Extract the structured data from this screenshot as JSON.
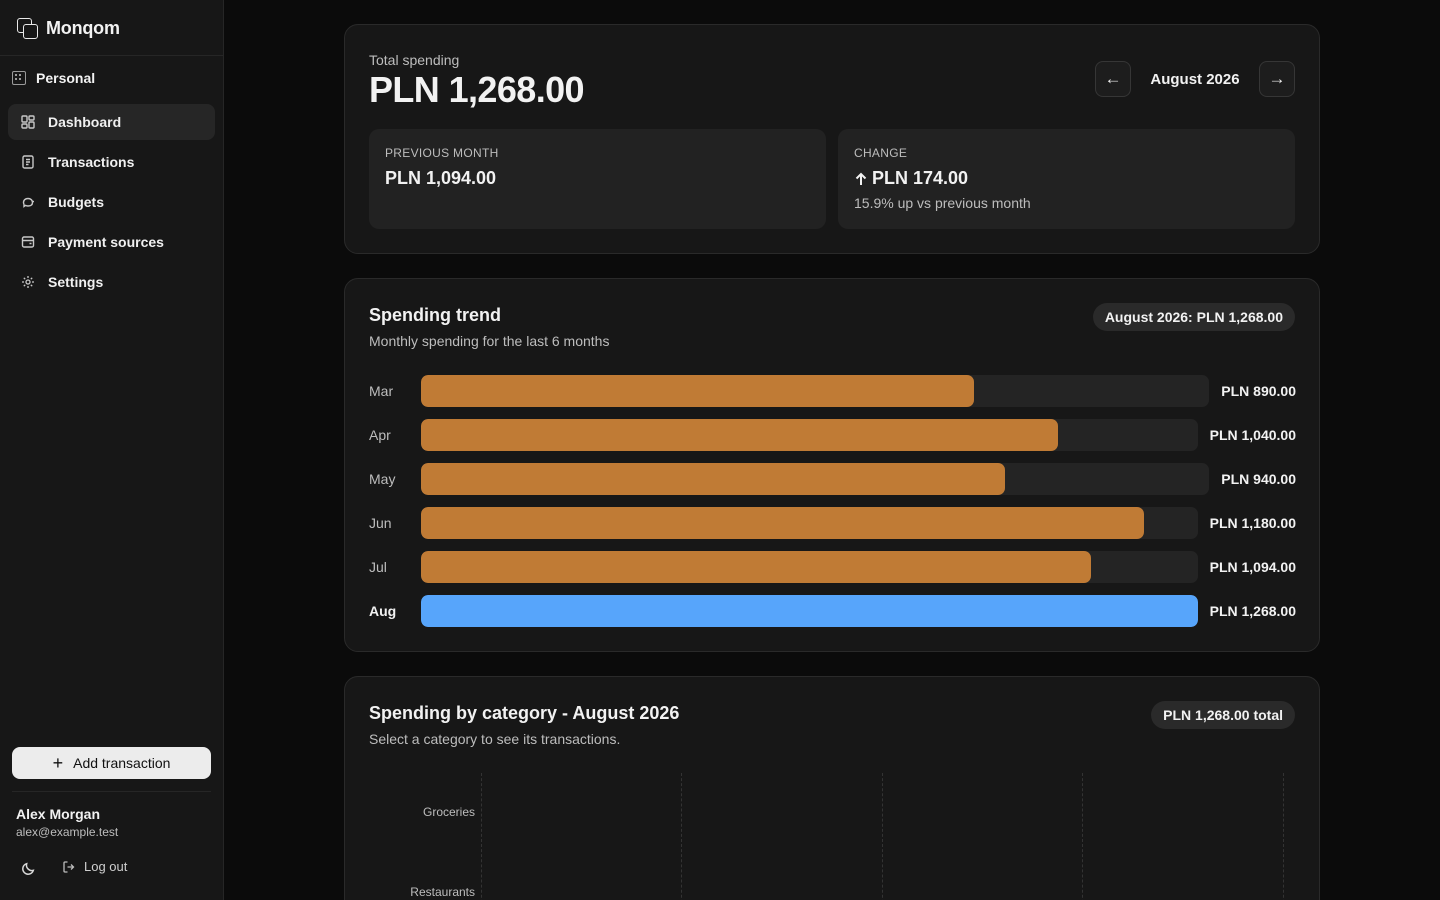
{
  "app": {
    "name": "Monqom"
  },
  "sidebar": {
    "workspace": "Personal",
    "items": [
      {
        "label": "Dashboard",
        "icon": "dashboard-icon",
        "active": true
      },
      {
        "label": "Transactions",
        "icon": "receipt-icon",
        "active": false
      },
      {
        "label": "Budgets",
        "icon": "piggy-bank-icon",
        "active": false
      },
      {
        "label": "Payment sources",
        "icon": "wallet-icon",
        "active": false
      },
      {
        "label": "Settings",
        "icon": "gear-icon",
        "active": false
      }
    ],
    "add_transaction": "Add transaction",
    "user": {
      "name": "Alex Morgan",
      "email": "alex@example.test"
    },
    "logout": "Log out"
  },
  "summary": {
    "label": "Total spending",
    "total": "PLN 1,268.00",
    "month": "August 2026",
    "previous": {
      "label": "PREVIOUS MONTH",
      "value": "PLN 1,094.00"
    },
    "change": {
      "label": "CHANGE",
      "value": "PLN 174.00",
      "direction": "up",
      "note": "15.9% up vs previous month"
    }
  },
  "trend": {
    "title": "Spending trend",
    "subtitle": "Monthly spending for the last 6 months",
    "badge": "August 2026: PLN 1,268.00"
  },
  "chart_data": {
    "type": "bar",
    "orientation": "horizontal",
    "categories": [
      "Mar",
      "Apr",
      "May",
      "Jun",
      "Jul",
      "Aug"
    ],
    "values": [
      890.0,
      1040.0,
      940.0,
      1180.0,
      1094.0,
      1268.0
    ],
    "value_labels": [
      "PLN 890.00",
      "PLN 1,040.00",
      "PLN 940.00",
      "PLN 1,180.00",
      "PLN 1,094.00",
      "PLN 1,268.00"
    ],
    "highlight_index": 5,
    "colors": {
      "default": "#c07b35",
      "highlight": "#57a5fb",
      "track": "#242424"
    }
  },
  "category": {
    "title": "Spending by category - August 2026",
    "subtitle": "Select a category to see its transactions.",
    "badge": "PLN 1,268.00 total",
    "labels": [
      "Groceries",
      "Restaurants"
    ]
  }
}
